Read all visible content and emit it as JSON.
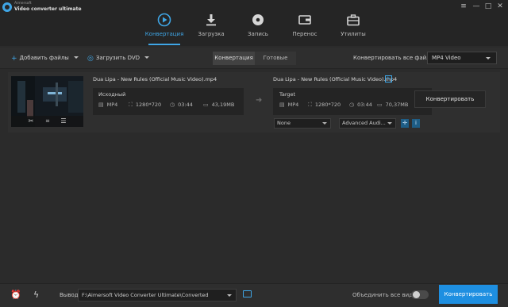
{
  "app": {
    "brand_small": "Aimersoft",
    "brand_big": "Video converter ultimate",
    "window_controls": [
      "≡",
      "—",
      "□",
      "✕"
    ]
  },
  "nav": {
    "items": [
      {
        "label": "Конвертация",
        "icon": "play-circle-icon",
        "active": true
      },
      {
        "label": "Загрузка",
        "icon": "download-icon",
        "active": false
      },
      {
        "label": "Запись",
        "icon": "disc-icon",
        "active": false
      },
      {
        "label": "Перенос",
        "icon": "transfer-icon",
        "active": false
      },
      {
        "label": "Утилиты",
        "icon": "toolbox-icon",
        "active": false
      }
    ]
  },
  "toolbar": {
    "add_files": "Добавить файлы",
    "load_dvd": "Загрузить DVD",
    "tabs": [
      "Конвертация",
      "Готовые"
    ],
    "convert_all_to": "Конвертировать все файлы в:",
    "format": "MP4 Video"
  },
  "file": {
    "source_title": "Dua Lipa - New Rules (Official Music Video).mp4",
    "target_title": "Dua Lipa - New Rules (Official Music Video).mp4",
    "source_caption": "Исходный",
    "target_caption": "Target",
    "source_meta": {
      "format": "MP4",
      "resolution": "1280*720",
      "duration": "03:44",
      "size": "43,19MB"
    },
    "target_meta": {
      "format": "MP4",
      "resolution": "1280*720",
      "duration": "03:44",
      "size": "70,37MB"
    },
    "subtitle_select": "None",
    "audio_select": "Advanced Audi...",
    "convert_button": "Конвертировать"
  },
  "bottom": {
    "output_label": "Вывод:",
    "output_path": "F:\\Aimersoft Video Converter Ultimate\\Converted",
    "merge_label": "Объединить все видео",
    "merge_enabled": false,
    "convert_all_button": "Конвертировать все"
  },
  "colors": {
    "accent": "#3fa6e6",
    "primary_button": "#1e8fe1",
    "background": "#2b2b2b"
  }
}
